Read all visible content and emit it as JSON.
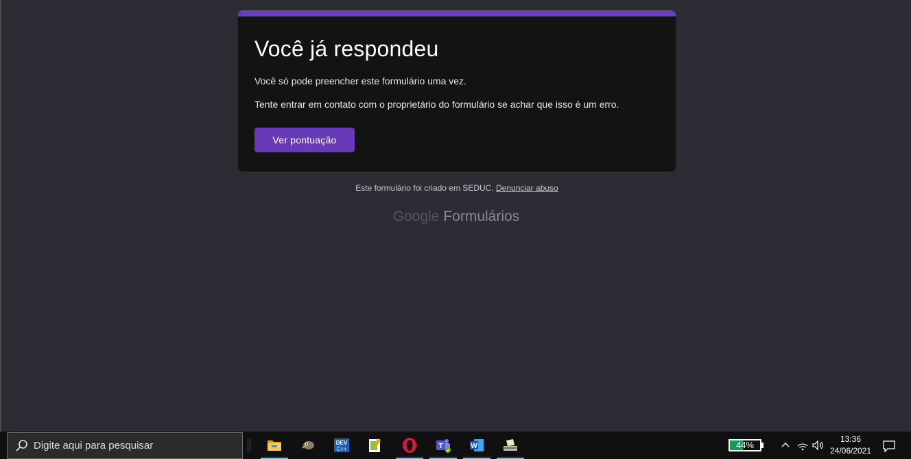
{
  "form": {
    "title": "Você já respondeu",
    "message_1": "Você só pode preencher este formulário uma vez.",
    "message_2": "Tente entrar em contato com o proprietário do formulário se achar que isso é um erro.",
    "button_label": "Ver pontuação",
    "accent_color": "#673ab7"
  },
  "footer": {
    "created_text": "Este formulário foi criado em SEDUC.",
    "report_link": "Denunciar abuso",
    "brand_google": "Google",
    "brand_product": "Formulários"
  },
  "taskbar": {
    "search_placeholder": "Digite aqui para pesquisar",
    "apps": [
      {
        "name": "file-explorer-icon",
        "active": true
      },
      {
        "name": "gimp-icon",
        "active": false
      },
      {
        "name": "dev-cpp-icon",
        "active": false
      },
      {
        "name": "notepad-plus-plus-icon",
        "active": false
      },
      {
        "name": "opera-icon",
        "active": true
      },
      {
        "name": "microsoft-teams-icon",
        "active": true
      },
      {
        "name": "microsoft-word-icon",
        "active": true
      },
      {
        "name": "scanner-icon",
        "active": true
      }
    ],
    "battery_percent_label": "44%",
    "battery_level": 0.44,
    "time": "13:36",
    "date": "24/06/2021"
  }
}
